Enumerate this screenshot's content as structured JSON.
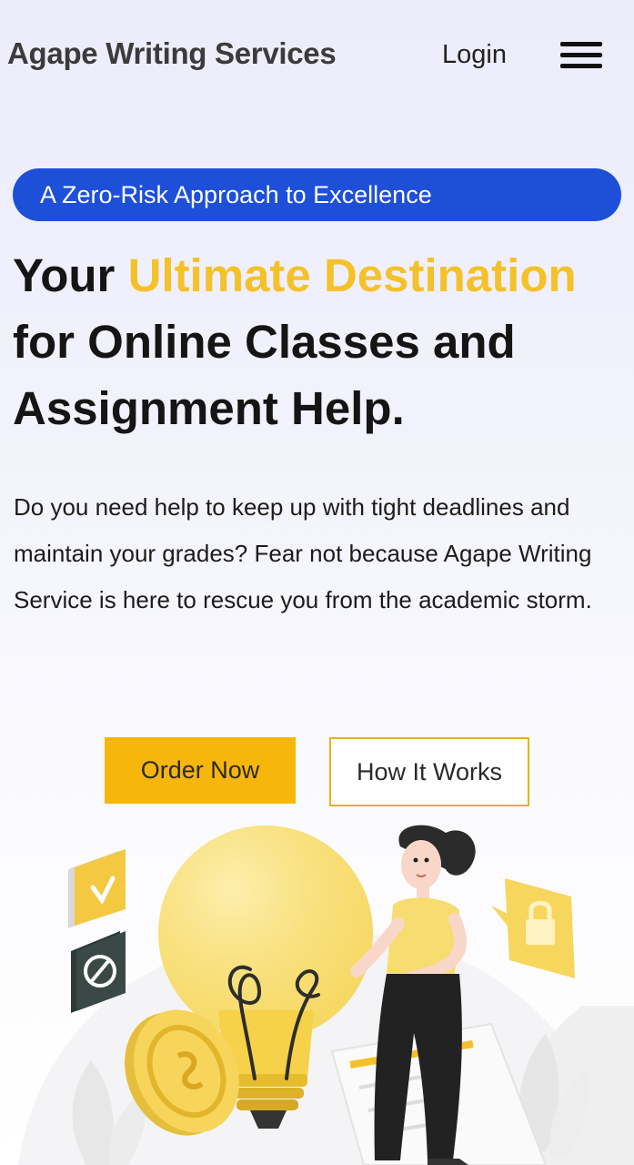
{
  "header": {
    "brand": "Agape Writing Services",
    "login_label": "Login",
    "menu_icon": "hamburger-menu-icon"
  },
  "hero": {
    "tagline": "A Zero-Risk Approach to Excellence",
    "headline_prefix": "Your",
    "headline_accent": "Ultimate Destination",
    "headline_line2": "for Online Classes and",
    "headline_line3": "Assignment Help.",
    "description": "Do you need help to keep up with tight deadlines and maintain your grades? Fear not because Agape Writing Service is here to rescue you from the academic storm.",
    "primary_cta": "Order Now",
    "secondary_cta": "How It Works"
  },
  "colors": {
    "accent_yellow": "#f5c12b",
    "button_yellow": "#f7b60b",
    "pill_blue": "#1d4fd8",
    "text_dark": "#151515"
  },
  "illustration": {
    "icons": [
      "checkbox-icon",
      "blocked-icon",
      "lightbulb-icon",
      "lock-icon",
      "coin-icon",
      "person-illustration"
    ]
  }
}
